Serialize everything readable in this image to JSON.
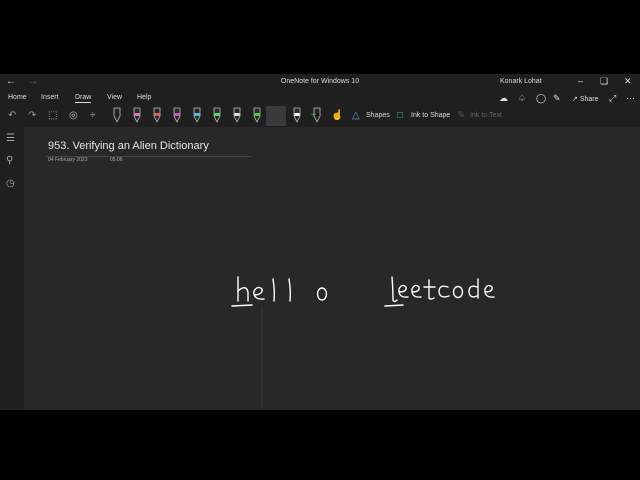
{
  "window": {
    "title": "OneNote for Windows 10",
    "user": "Konark Lohat"
  },
  "menu": {
    "tabs": [
      "Home",
      "Insert",
      "Draw",
      "View",
      "Help"
    ],
    "active": "Draw",
    "share_label": "Share"
  },
  "toolbar": {
    "shapes_label": "Shapes",
    "ink_to_shape_label": "Ink to Shape",
    "ink_to_text_label": "Ink to Text",
    "pens": [
      {
        "name": "pen-black",
        "color": "#1a1a1a"
      },
      {
        "name": "pen-pink",
        "color": "#e070c0"
      },
      {
        "name": "pen-red",
        "color": "#e06050"
      },
      {
        "name": "pen-magenta",
        "color": "#d050d0"
      },
      {
        "name": "pen-cyan",
        "color": "#40c0e0"
      },
      {
        "name": "highlighter-green",
        "color": "#50e060"
      },
      {
        "name": "pen-white",
        "color": "#e0e0e0"
      },
      {
        "name": "pen-green",
        "color": "#40d040"
      },
      {
        "name": "pen-blue",
        "color": "#4070e0"
      },
      {
        "name": "pen-white-selected",
        "color": "#ffffff"
      },
      {
        "name": "pen-dark",
        "color": "#111111"
      }
    ]
  },
  "page": {
    "title": "953. Verifying an Alien Dictionary",
    "date": "04 February 2023",
    "time": "05:06",
    "ink_words": [
      "hello",
      "leetcode"
    ]
  },
  "colors": {
    "background": "#282828",
    "chrome": "#1f1f1f",
    "ink": "#ffffff"
  }
}
